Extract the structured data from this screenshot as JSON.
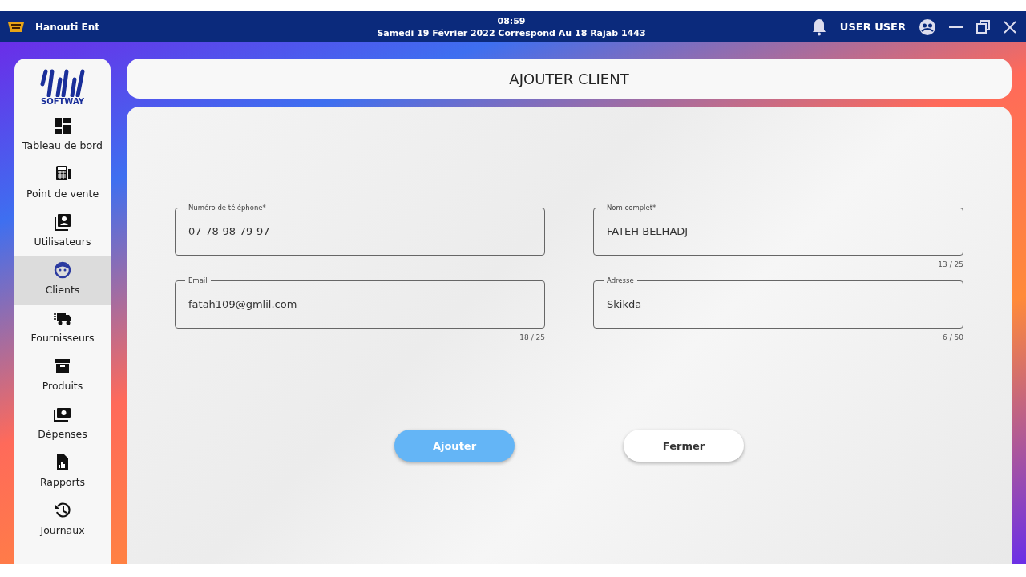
{
  "window": {
    "title": "Hanouti Ent",
    "time": "08:59",
    "date": "Samedi 19 Février 2022 Correspond Au 18 Rajab 1443",
    "user": "USER USER"
  },
  "sidebar": {
    "logo_text": "SOFTWAY",
    "items": [
      {
        "label": "Tableau de bord",
        "selected": false
      },
      {
        "label": "Point de vente",
        "selected": false
      },
      {
        "label": "Utilisateurs",
        "selected": false
      },
      {
        "label": "Clients",
        "selected": true
      },
      {
        "label": "Fournisseurs",
        "selected": false
      },
      {
        "label": "Produits",
        "selected": false
      },
      {
        "label": "Dépenses",
        "selected": false
      },
      {
        "label": "Rapports",
        "selected": false
      },
      {
        "label": "Journaux",
        "selected": false
      }
    ]
  },
  "header": {
    "title": "AJOUTER CLIENT"
  },
  "form": {
    "fields": [
      {
        "label": "Numéro de téléphone*",
        "value": "07-78-98-79-97"
      },
      {
        "label": "Nom complet*",
        "value": "FATEH BELHADJ",
        "counter": "13 / 25"
      },
      {
        "label": "Email",
        "value": "fatah109@gmlil.com",
        "counter": "18 / 25"
      },
      {
        "label": "Adresse",
        "value": "Skikda",
        "counter": "6 / 50"
      }
    ],
    "buttons": [
      {
        "label": "Ajouter",
        "kind": "primary"
      },
      {
        "label": "Fermer",
        "kind": "secondary"
      }
    ]
  }
}
